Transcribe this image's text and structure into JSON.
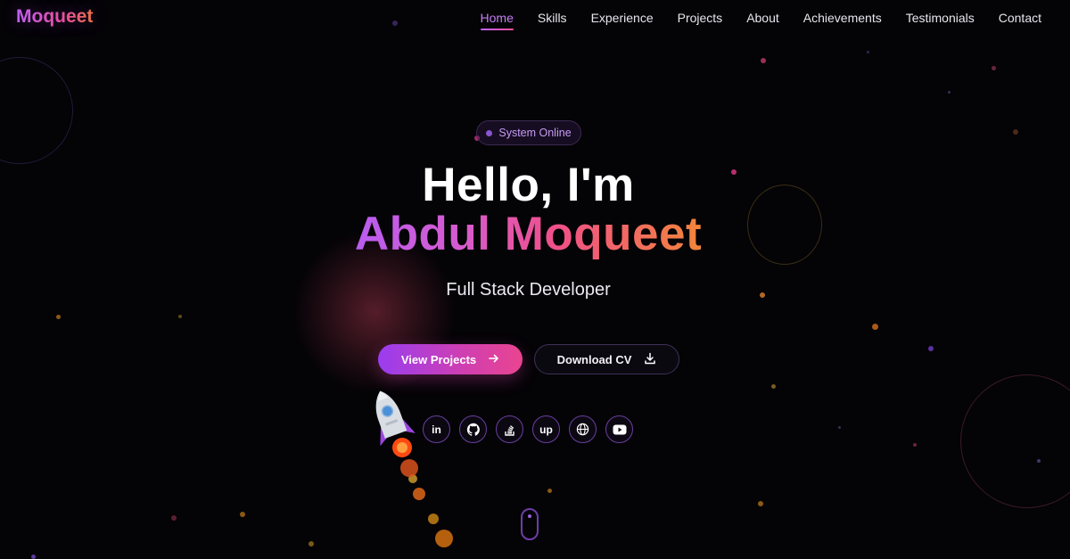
{
  "nav": {
    "logo": "Moqueet",
    "items": [
      {
        "label": "Home",
        "active": true
      },
      {
        "label": "Skills",
        "active": false
      },
      {
        "label": "Experience",
        "active": false
      },
      {
        "label": "Projects",
        "active": false
      },
      {
        "label": "About",
        "active": false
      },
      {
        "label": "Achievements",
        "active": false
      },
      {
        "label": "Testimonials",
        "active": false
      },
      {
        "label": "Contact",
        "active": false
      }
    ]
  },
  "hero": {
    "status": "System Online",
    "greeting": "Hello, I'm",
    "name": "Abdul Moqueet",
    "role": "Full Stack Developer",
    "primary_button": "View Projects",
    "primary_icon": "arrow-right-icon",
    "secondary_button": "Download CV",
    "secondary_icon": "download-icon"
  },
  "socials": [
    {
      "name": "linkedin-icon",
      "glyph": "in"
    },
    {
      "name": "github-icon",
      "glyph": ""
    },
    {
      "name": "stackoverflow-icon",
      "glyph": ""
    },
    {
      "name": "upwork-icon",
      "glyph": "up"
    },
    {
      "name": "globe-icon",
      "glyph": ""
    },
    {
      "name": "youtube-icon",
      "glyph": ""
    }
  ],
  "colors": {
    "background": "#040306",
    "accent_purple": "#c061f5",
    "accent_pink": "#ef4f9a",
    "accent_orange": "#f0733e",
    "nav_active": "#c77df5"
  }
}
